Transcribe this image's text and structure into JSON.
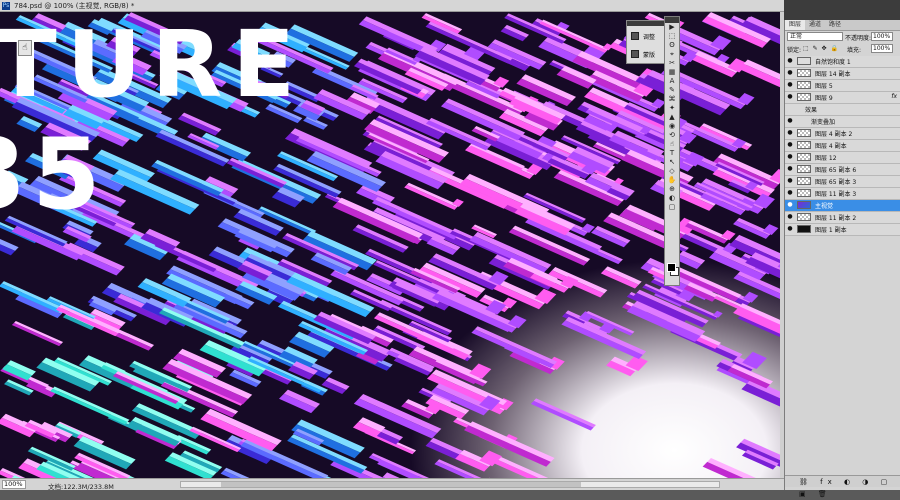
{
  "window": {
    "doc_title": "784.psd @ 100% (主视觉, RGB/8) *"
  },
  "status": {
    "zoom": "100%",
    "doc_info": "文档:122.3M/233.8M"
  },
  "canvas_text": {
    "line1": "TURE",
    "line2": "35"
  },
  "mini_panel": {
    "items": [
      {
        "label": "调整",
        "icon": "adjust-icon"
      },
      {
        "label": "蒙版",
        "icon": "mask-icon"
      }
    ]
  },
  "toolbox": {
    "tools": [
      "▶",
      "⬚",
      "ʘ",
      "⌖",
      "✂",
      "▦",
      "A",
      "✎",
      "⌘",
      "✦",
      "▲",
      "◉",
      "⟲",
      "☝",
      "T",
      "↖",
      "◇",
      "✋",
      "⊕",
      "◐",
      "▢"
    ]
  },
  "layers_panel": {
    "tabs": [
      "图层",
      "通道",
      "路径"
    ],
    "blend_mode": "正常",
    "opacity_label": "不透明度:",
    "opacity_value": "100%",
    "lock_label": "锁定:",
    "lock_icons": "⬚ ✎ ✥ 🔒",
    "fill_label": "填充:",
    "fill_value": "100%",
    "layers": [
      {
        "name": "自然饱和度 1",
        "thumb": "adj",
        "eye": "●",
        "selected": false,
        "type": "layer"
      },
      {
        "name": "图层 14 副本",
        "thumb": "trans",
        "eye": "●",
        "selected": false,
        "type": "layer"
      },
      {
        "name": "图层 5",
        "thumb": "trans",
        "eye": "●",
        "selected": false,
        "type": "layer"
      },
      {
        "name": "图层 9",
        "thumb": "trans",
        "eye": "●",
        "selected": false,
        "type": "layer",
        "fx": "fx"
      },
      {
        "name": "效果",
        "thumb": "",
        "eye": "",
        "selected": false,
        "type": "effect"
      },
      {
        "name": "渐变叠加",
        "thumb": "",
        "eye": "●",
        "selected": false,
        "type": "sub"
      },
      {
        "name": "图层 4 副本 2",
        "thumb": "trans",
        "eye": "●",
        "selected": false,
        "type": "layer"
      },
      {
        "name": "图层 4 副本",
        "thumb": "trans",
        "eye": "●",
        "selected": false,
        "type": "layer"
      },
      {
        "name": "图层 12",
        "thumb": "trans",
        "eye": "●",
        "selected": false,
        "type": "layer"
      },
      {
        "name": "图层 65 副本 6",
        "thumb": "trans",
        "eye": "●",
        "selected": false,
        "type": "layer"
      },
      {
        "name": "图层 65 副本 3",
        "thumb": "trans",
        "eye": "●",
        "selected": false,
        "type": "layer"
      },
      {
        "name": "图层 11 副本 3",
        "thumb": "trans",
        "eye": "●",
        "selected": false,
        "type": "layer"
      },
      {
        "name": "主视觉",
        "thumb": "photo",
        "eye": "●",
        "selected": true,
        "type": "layer"
      },
      {
        "name": "图层 11 副本 2",
        "thumb": "trans",
        "eye": "●",
        "selected": false,
        "type": "layer"
      },
      {
        "name": "图层 1 副本",
        "thumb": "dark",
        "eye": "●",
        "selected": false,
        "type": "layer"
      }
    ],
    "footer_icons": "⛓ fx ◐ ◑ ▢ ▣ 🗑"
  },
  "colors": {
    "selected": "#3a8ee6",
    "canvas_bg": "#160a26"
  }
}
